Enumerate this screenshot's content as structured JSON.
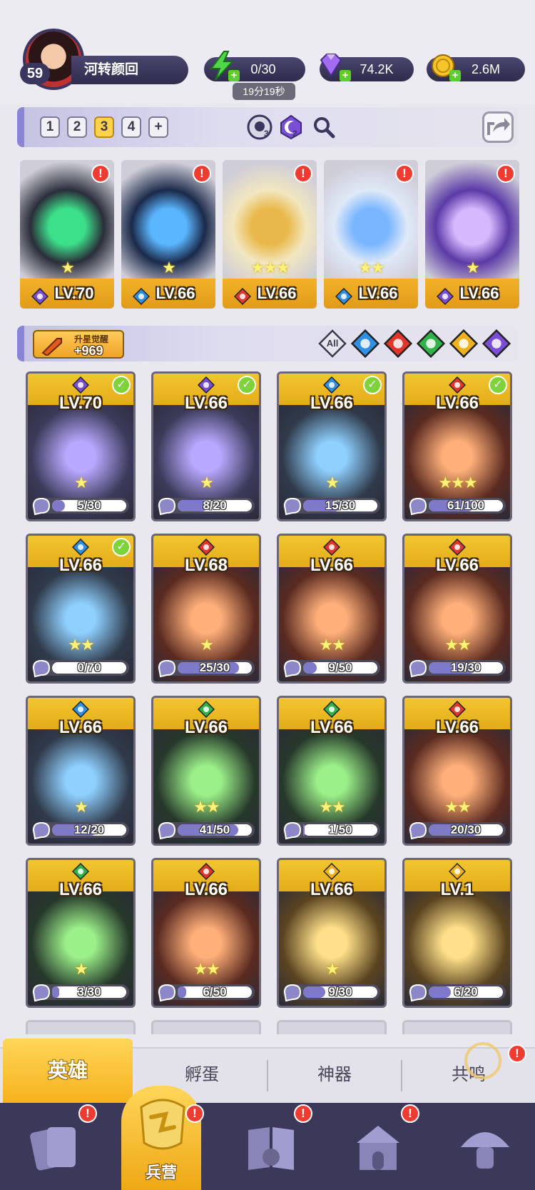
{
  "player": {
    "level": "59",
    "name": "河转颜回"
  },
  "resources": {
    "stamina": "0/30",
    "stamina_timer": "19分19秒",
    "gems": "74.2K",
    "gold": "2.6M"
  },
  "teams": {
    "tabs": [
      "1",
      "2",
      "3",
      "4",
      "+"
    ],
    "active_tab": "3",
    "counter_a": "3",
    "counter_b": "2"
  },
  "team_cards": [
    {
      "level": "LV.70",
      "element": "moon",
      "stars": "★",
      "alert": "!"
    },
    {
      "level": "LV.66",
      "element": "water",
      "stars": "★",
      "alert": "!"
    },
    {
      "level": "LV.66",
      "element": "fire",
      "stars": "★★★",
      "alert": "!"
    },
    {
      "level": "LV.66",
      "element": "water",
      "stars": "★★",
      "alert": "!"
    },
    {
      "level": "LV.66",
      "element": "moon",
      "stars": "★",
      "alert": "!"
    }
  ],
  "awaken": {
    "label": "升星觉醒",
    "value": "+969"
  },
  "filters": [
    "All",
    "water",
    "fire",
    "wind",
    "light",
    "moon"
  ],
  "heroes": [
    {
      "level": "LV.70",
      "element": "moon",
      "checked": true,
      "stars": "★",
      "progress": "5/30",
      "fill": 0.17
    },
    {
      "level": "LV.66",
      "element": "moon",
      "checked": true,
      "stars": "★",
      "progress": "8/20",
      "fill": 0.4
    },
    {
      "level": "LV.66",
      "element": "water",
      "checked": true,
      "stars": "★",
      "progress": "15/30",
      "fill": 0.5
    },
    {
      "level": "LV.66",
      "element": "fire",
      "checked": true,
      "stars": "★★★",
      "progress": "61/100",
      "fill": 0.61
    },
    {
      "level": "LV.66",
      "element": "water",
      "checked": true,
      "stars": "★★",
      "progress": "0/70",
      "fill": 0.0
    },
    {
      "level": "LV.68",
      "element": "fire",
      "checked": false,
      "stars": "★",
      "progress": "25/30",
      "fill": 0.83
    },
    {
      "level": "LV.66",
      "element": "fire",
      "checked": false,
      "stars": "★★",
      "progress": "9/50",
      "fill": 0.18
    },
    {
      "level": "LV.66",
      "element": "fire",
      "checked": false,
      "stars": "★★",
      "progress": "19/30",
      "fill": 0.63
    },
    {
      "level": "LV.66",
      "element": "water",
      "checked": false,
      "stars": "★",
      "progress": "12/20",
      "fill": 0.6
    },
    {
      "level": "LV.66",
      "element": "wind",
      "checked": false,
      "stars": "★★",
      "progress": "41/50",
      "fill": 0.82
    },
    {
      "level": "LV.66",
      "element": "wind",
      "checked": false,
      "stars": "★★",
      "progress": "1/50",
      "fill": 0.02
    },
    {
      "level": "LV.66",
      "element": "fire",
      "checked": false,
      "stars": "★★",
      "progress": "20/30",
      "fill": 0.67
    },
    {
      "level": "LV.66",
      "element": "wind",
      "checked": false,
      "stars": "★",
      "progress": "3/30",
      "fill": 0.1
    },
    {
      "level": "LV.66",
      "element": "fire",
      "checked": false,
      "stars": "★★",
      "progress": "6/50",
      "fill": 0.12
    },
    {
      "level": "LV.66",
      "element": "light",
      "checked": false,
      "stars": "★",
      "progress": "9/30",
      "fill": 0.3
    },
    {
      "level": "LV.1",
      "element": "light",
      "checked": false,
      "stars": "",
      "progress": "6/20",
      "fill": 0.3
    }
  ],
  "subtabs": [
    "英雄",
    "孵蛋",
    "神器",
    "共鸣"
  ],
  "nav": {
    "active_label": "兵营"
  },
  "colors": {
    "moon": "#7a4fd6",
    "water": "#2f8fe0",
    "fire": "#e2352b",
    "wind": "#2fb34a",
    "light": "#f0b21c",
    "accent": "#f6b21c",
    "navbar": "#3b3859"
  }
}
